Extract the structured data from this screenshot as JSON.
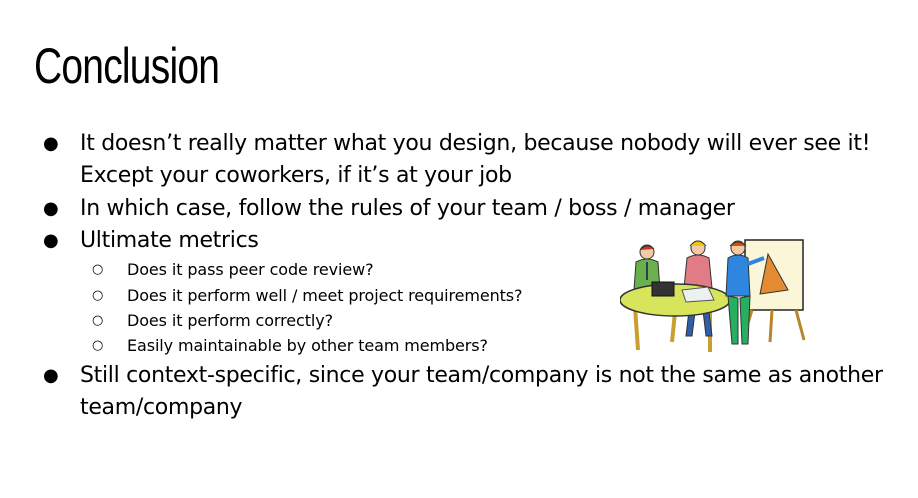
{
  "slide": {
    "title": "Conclusion",
    "bullets": [
      {
        "line1": "It doesn’t really matter what you design, because nobody will ever see it!",
        "line2": "Except your coworkers, if it’s at your job"
      },
      {
        "line1": "In which case, follow the rules of your team / boss / manager"
      },
      {
        "line1": "Ultimate metrics"
      },
      {
        "line1": "Still context-specific, since your team/company is not the same as another",
        "line2": "team/company"
      }
    ],
    "sub_bullets": [
      "Does it pass peer code review?",
      "Does it perform well / meet project requirements?",
      "Does it perform correctly?",
      "Easily maintainable by other team members?"
    ],
    "bullet_glyph": "●",
    "sub_bullet_glyph": "○",
    "illustration": "team-meeting-clipart-icon"
  }
}
